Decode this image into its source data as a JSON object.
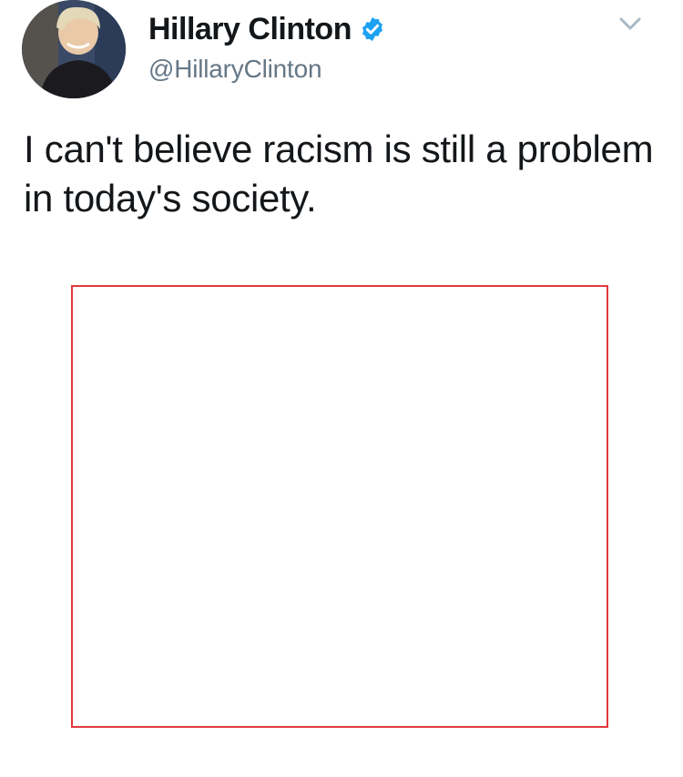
{
  "tweet": {
    "display_name": "Hillary Clinton",
    "handle": "@HillaryClinton",
    "text": "I can't believe racism is still a problem in today's society.",
    "verified_icon": "verified-badge-icon",
    "menu_icon": "chevron-down-icon"
  },
  "colors": {
    "verified": "#1da1f2",
    "handle": "#657786",
    "media_border": "#e0383e"
  }
}
